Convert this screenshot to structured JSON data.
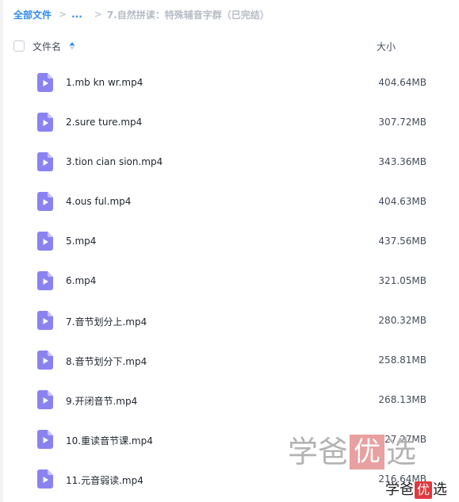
{
  "breadcrumb": {
    "root": "全部文件",
    "separator": ">",
    "ellipsis": "...",
    "current": "7.自然拼读：特殊辅音字群（已完结）"
  },
  "header": {
    "name_label": "文件名",
    "size_label": "大小"
  },
  "files": [
    {
      "name": "1.mb kn wr.mp4",
      "size": "404.64MB"
    },
    {
      "name": "2.sure ture.mp4",
      "size": "307.72MB"
    },
    {
      "name": "3.tion cian sion.mp4",
      "size": "343.36MB"
    },
    {
      "name": "4.ous ful.mp4",
      "size": "404.63MB"
    },
    {
      "name": "5.mp4",
      "size": "437.56MB"
    },
    {
      "name": "6.mp4",
      "size": "321.05MB"
    },
    {
      "name": "7.音节划分上.mp4",
      "size": "280.32MB"
    },
    {
      "name": "8.音节划分下.mp4",
      "size": "258.81MB"
    },
    {
      "name": "9.开闭音节.mp4",
      "size": "268.13MB"
    },
    {
      "name": "10.重读音节课.mp4",
      "size": "327.27MB"
    },
    {
      "name": "11.元音弱读.mp4",
      "size": "216.64MB"
    }
  ],
  "watermark": {
    "chars": [
      "学",
      "爸",
      "优",
      "选"
    ]
  },
  "logo": {
    "chars": [
      "学",
      "爸",
      "优",
      "选"
    ]
  },
  "colors": {
    "accent": "#2e8cf0",
    "video_icon": "#8b82f2",
    "video_icon_fold": "#c7c2fa",
    "watermark_box": "#e9a0a0",
    "logo_box": "#e0393e"
  },
  "icons": {
    "file": "video-file-icon",
    "sort": "sort-ascending-icon"
  }
}
